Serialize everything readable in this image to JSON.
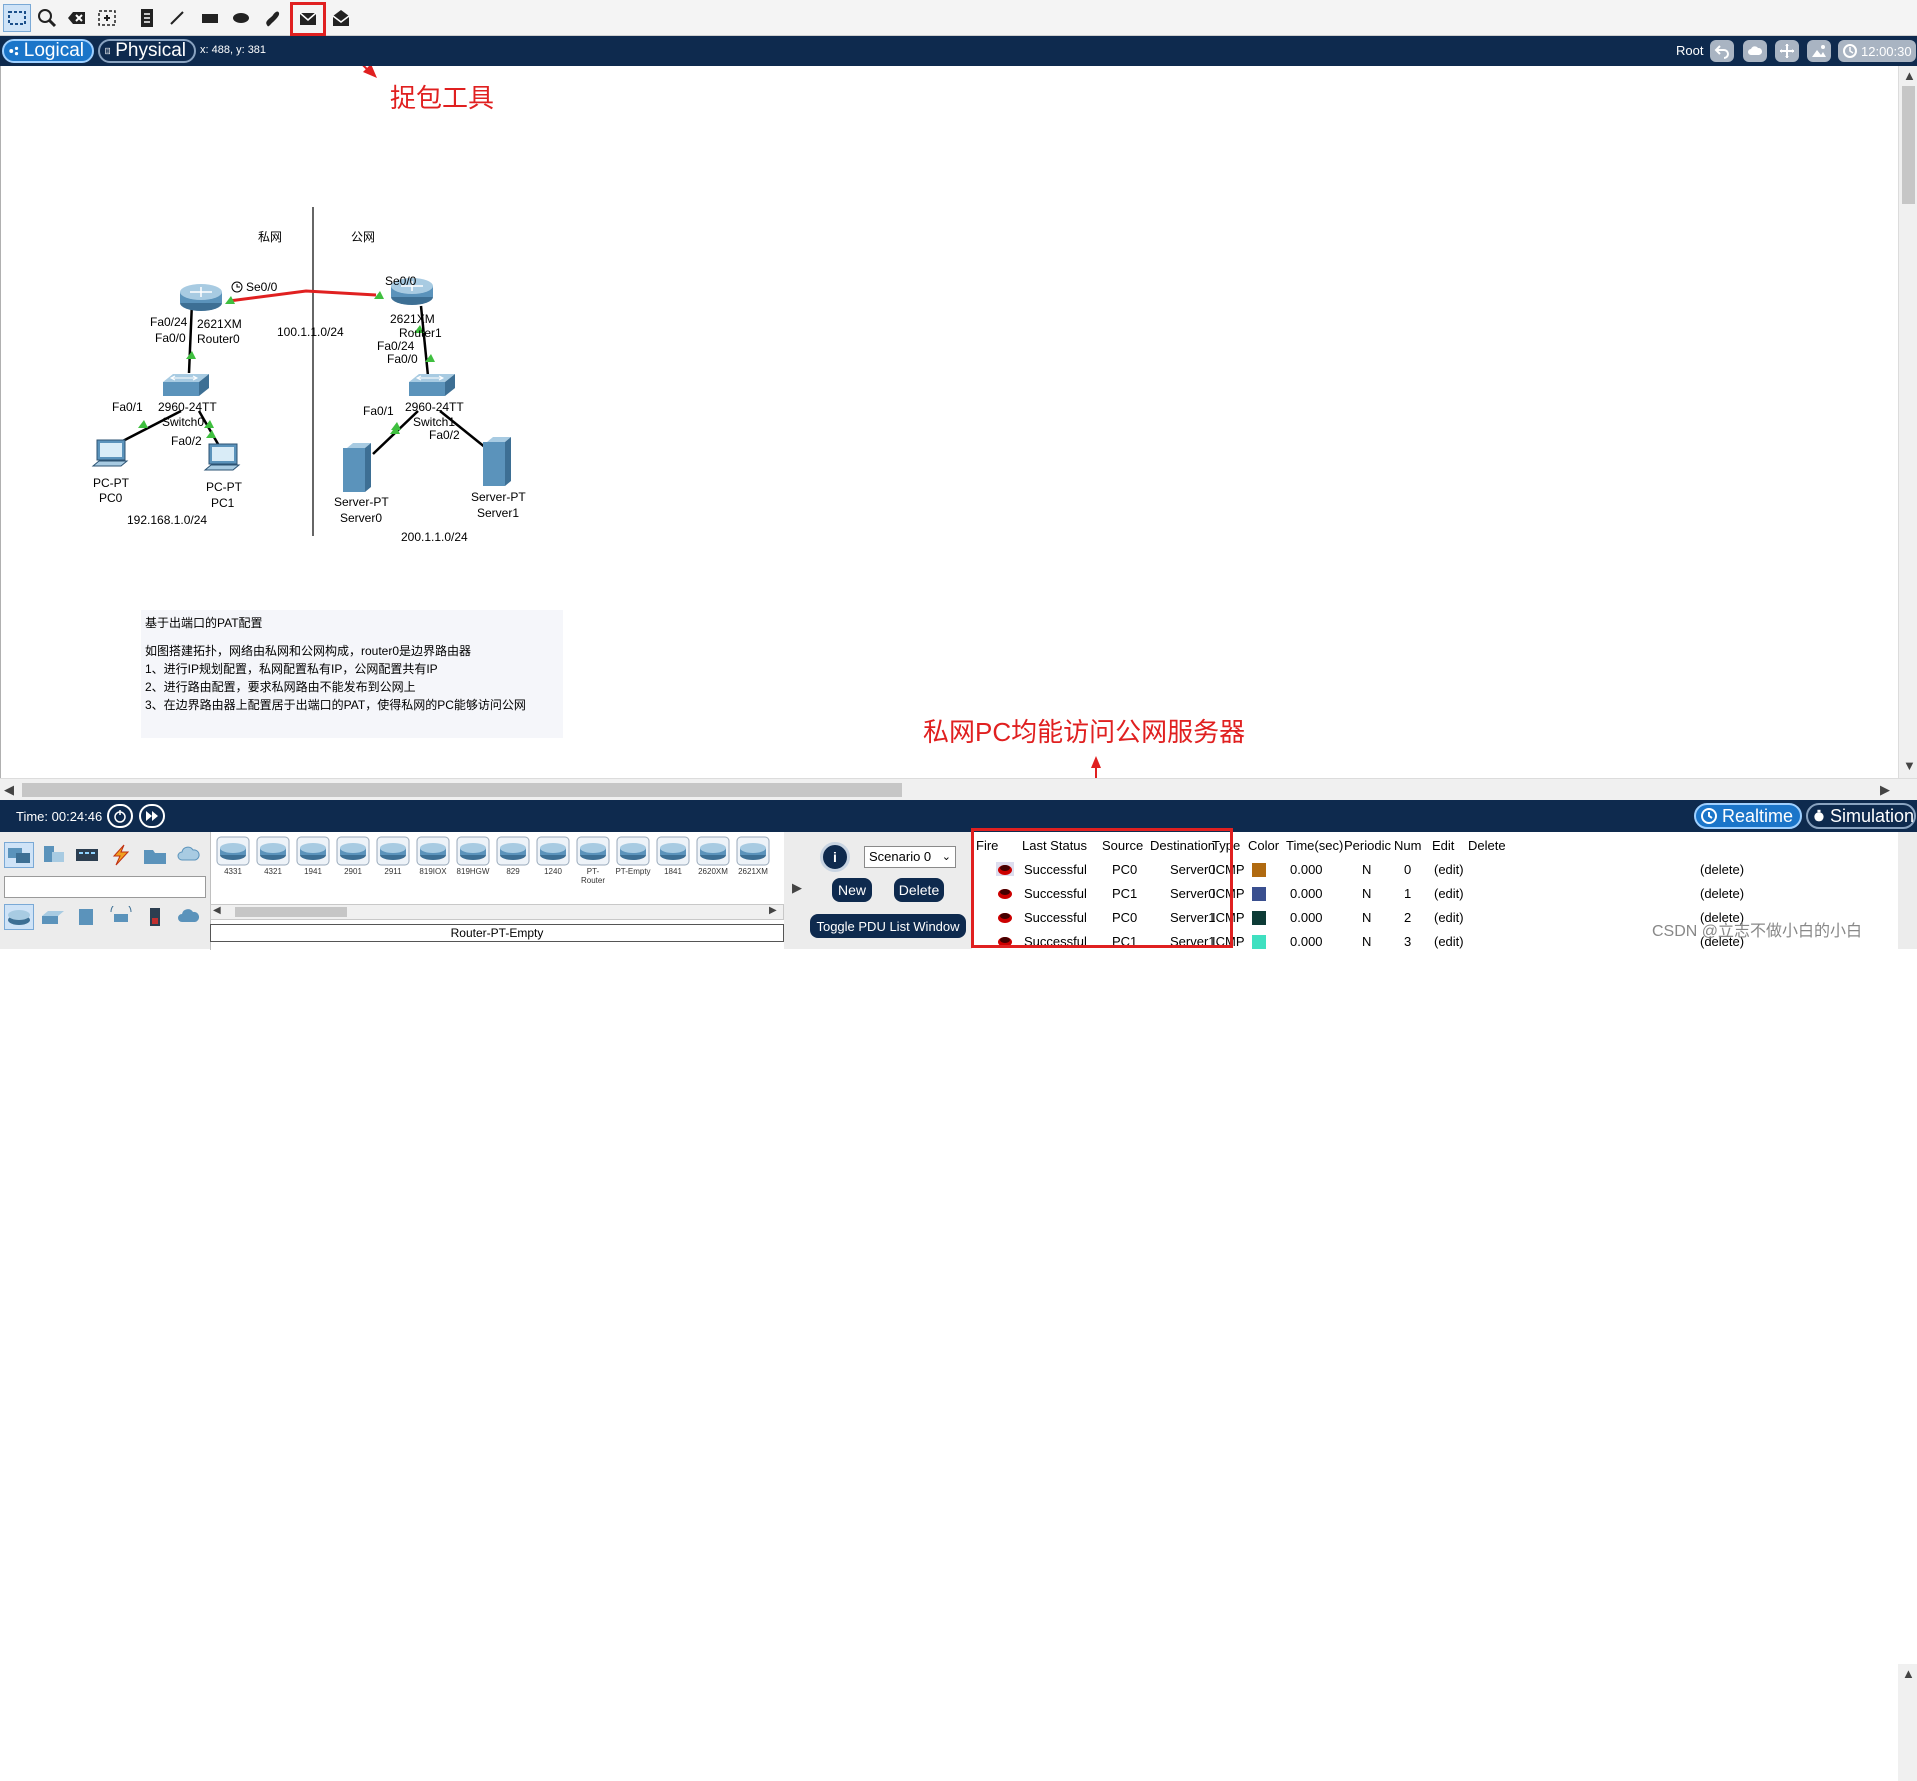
{
  "toolbar": {
    "tools": [
      "select-tool",
      "inspect-tool",
      "delete-tool",
      "resize-shape-tool",
      "place-note-tool",
      "draw-line-tool",
      "draw-rectangle-tool",
      "draw-ellipse-tool",
      "freeform-tool",
      "add-simple-pdu-tool",
      "add-complex-pdu-tool"
    ]
  },
  "modebar": {
    "logical_label": "Logical",
    "physical_label": "Physical",
    "coords": "x: 488, y: 381",
    "root_label": "Root",
    "clock": "12:00:30"
  },
  "topology": {
    "private_label": "私网",
    "public_label": "公网",
    "router0": {
      "model": "2621XM",
      "name": "Router0",
      "if_se": "Se0/0",
      "if_fa24": "Fa0/24",
      "if_fa00": "Fa0/0"
    },
    "router1": {
      "model": "2621XM",
      "name": "Router1",
      "if_se": "Se0/0",
      "if_fa24": "Fa0/24",
      "if_fa00": "Fa0/0"
    },
    "wan_net": "100.1.1.0/24",
    "switch0": {
      "model": "2960-24TT",
      "name": "Switch0",
      "if_fa01": "Fa0/1",
      "if_fa02": "Fa0/2"
    },
    "switch1": {
      "model": "2960-24TT",
      "name": "Switch1",
      "if_fa01": "Fa0/1",
      "if_fa02": "Fa0/2"
    },
    "pc0": {
      "type": "PC-PT",
      "name": "PC0"
    },
    "pc1": {
      "type": "PC-PT",
      "name": "PC1"
    },
    "server0": {
      "type": "Server-PT",
      "name": "Server0"
    },
    "server1": {
      "type": "Server-PT",
      "name": "Server1"
    },
    "private_net": "192.168.1.0/24",
    "public_net": "200.1.1.0/24"
  },
  "note": {
    "title": "基于出端口的PAT配置",
    "line1": "如图搭建拓扑，网络由私网和公网构成，router0是边界路由器",
    "line2": "1、进行IP规划配置，私网配置私有IP，公网配置共有IP",
    "line3": "2、进行路由配置，要求私网路由不能发布到公网上",
    "line4": "3、在边界路由器上配置居于出端口的PAT，使得私网的PC能够访问公网"
  },
  "annotations": {
    "capture_tool": "捉包工具",
    "private_access": "私网PC均能访问公网服务器"
  },
  "timebar": {
    "time": "Time: 00:24:46",
    "realtime_label": "Realtime",
    "simulation_label": "Simulation"
  },
  "device_list": {
    "models": [
      "4331",
      "4321",
      "1941",
      "2901",
      "2911",
      "819IOX",
      "819HGW",
      "829",
      "1240",
      "PT-Router",
      "PT-Empty",
      "1841",
      "2620XM",
      "2621XM"
    ],
    "selected_name": "Router-PT-Empty"
  },
  "pdu": {
    "scenario": "Scenario 0",
    "new_label": "New",
    "delete_label": "Delete",
    "toggle_label": "Toggle PDU List Window",
    "headers": [
      "Fire",
      "Last Status",
      "Source",
      "Destination",
      "Type",
      "Color",
      "Time(sec)",
      "Periodic",
      "Num",
      "Edit",
      "Delete"
    ],
    "rows": [
      {
        "status": "Successful",
        "source": "PC0",
        "destination": "Server0",
        "type": "ICMP",
        "color": "#b06a10",
        "time": "0.000",
        "periodic": "N",
        "num": "0",
        "edit": "(edit)",
        "delete": "(delete)"
      },
      {
        "status": "Successful",
        "source": "PC1",
        "destination": "Server0",
        "type": "ICMP",
        "color": "#3a4f8f",
        "time": "0.000",
        "periodic": "N",
        "num": "1",
        "edit": "(edit)",
        "delete": "(delete)"
      },
      {
        "status": "Successful",
        "source": "PC0",
        "destination": "Server1",
        "type": "ICMP",
        "color": "#0d3b36",
        "time": "0.000",
        "periodic": "N",
        "num": "2",
        "edit": "(edit)",
        "delete": "(delete)"
      },
      {
        "status": "Successful",
        "source": "PC1",
        "destination": "Server1",
        "type": "ICMP",
        "color": "#3fe0c0",
        "time": "0.000",
        "periodic": "N",
        "num": "3",
        "edit": "(edit)",
        "delete": "(delete)"
      }
    ]
  },
  "watermark": "CSDN @立志不做小白的小白",
  "colors": {
    "highlight": "#e02020",
    "navy": "#0e2a4e",
    "accent": "#1b75c9"
  }
}
